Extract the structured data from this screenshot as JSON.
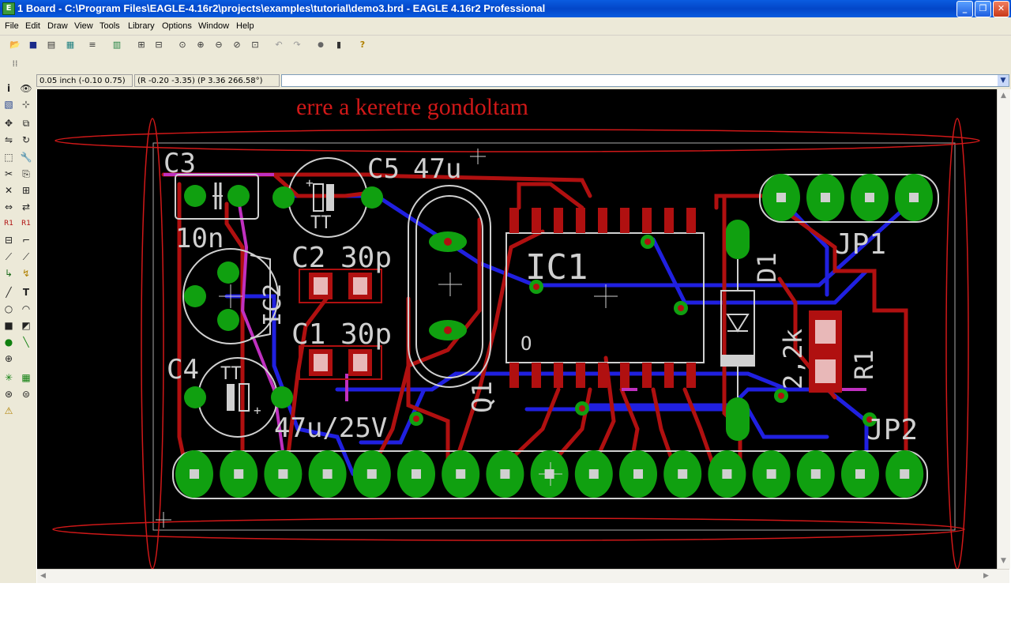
{
  "window": {
    "title": "1 Board - C:\\Program Files\\EAGLE-4.16r2\\projects\\examples\\tutorial\\demo3.brd - EAGLE 4.16r2 Professional",
    "app_icon": "eagle-app-icon",
    "minimize": "_",
    "maximize": "❐",
    "close": "✕"
  },
  "menu": [
    "File",
    "Edit",
    "Draw",
    "View",
    "Tools",
    "Library",
    "Options",
    "Window",
    "Help"
  ],
  "coords": {
    "grid": "0.05 inch (-0.10 0.75)",
    "polar": "(R -0.20 -3.35) (P 3.36 266.58°)",
    "command_value": ""
  },
  "annotation": "erre a keretre gondoltam",
  "board": {
    "parts": [
      {
        "name": "C3",
        "value": "10n"
      },
      {
        "name": "C5",
        "value": "47u"
      },
      {
        "name": "C2",
        "value": "30p"
      },
      {
        "name": "C1",
        "value": "30p"
      },
      {
        "name": "IC1",
        "value": ""
      },
      {
        "name": "IC2",
        "value": ""
      },
      {
        "name": "C4",
        "value": "47u/25V"
      },
      {
        "name": "Q1",
        "value": ""
      },
      {
        "name": "D1",
        "value": ""
      },
      {
        "name": "R1",
        "value": "2,2k"
      },
      {
        "name": "JP1",
        "value": ""
      },
      {
        "name": "JP2",
        "value": ""
      }
    ],
    "glyphs": {
      "tt": "TT",
      "plus": "+",
      "pin1": "O"
    }
  },
  "colors": {
    "canvas": "#000000",
    "top_layer": "#b01010",
    "bottom_layer": "#1a1ad8",
    "pads": "#10a010",
    "silkscreen": "#d0d0d0",
    "annotation": "#d01818",
    "titlebar": "#0a5ce0"
  },
  "icons": {
    "toolbar": [
      "open-icon",
      "save-icon",
      "print-icon",
      "cam-icon",
      "script-icon",
      "library-icon",
      "ulp-icon",
      "run-ulp-icon",
      "zoom-fit-icon",
      "zoom-in-icon",
      "zoom-out-icon",
      "zoom-redraw-icon",
      "zoom-select-icon",
      "undo-icon",
      "redo-icon",
      "stop-icon",
      "go-icon",
      "help-icon"
    ],
    "sidebar": [
      "info-icon",
      "show-icon",
      "display-icon",
      "mark-icon",
      "move-icon",
      "copy-icon",
      "mirror-icon",
      "rotate-icon",
      "group-icon",
      "change-icon",
      "cut-icon",
      "paste-icon",
      "delete-icon",
      "add-icon",
      "pinswap-icon",
      "replace-icon",
      "name-icon",
      "value-icon",
      "smash-icon",
      "miter-icon",
      "split-icon",
      "optimize-icon",
      "route-icon",
      "ripup-icon",
      "wire-icon",
      "text-icon",
      "circle-icon",
      "arc-icon",
      "rect-icon",
      "polygon-icon",
      "via-icon",
      "signal-icon",
      "hole-icon",
      "ratsnest-icon",
      "auto-icon",
      "erc-icon",
      "drc-icon",
      "errors-icon"
    ]
  }
}
